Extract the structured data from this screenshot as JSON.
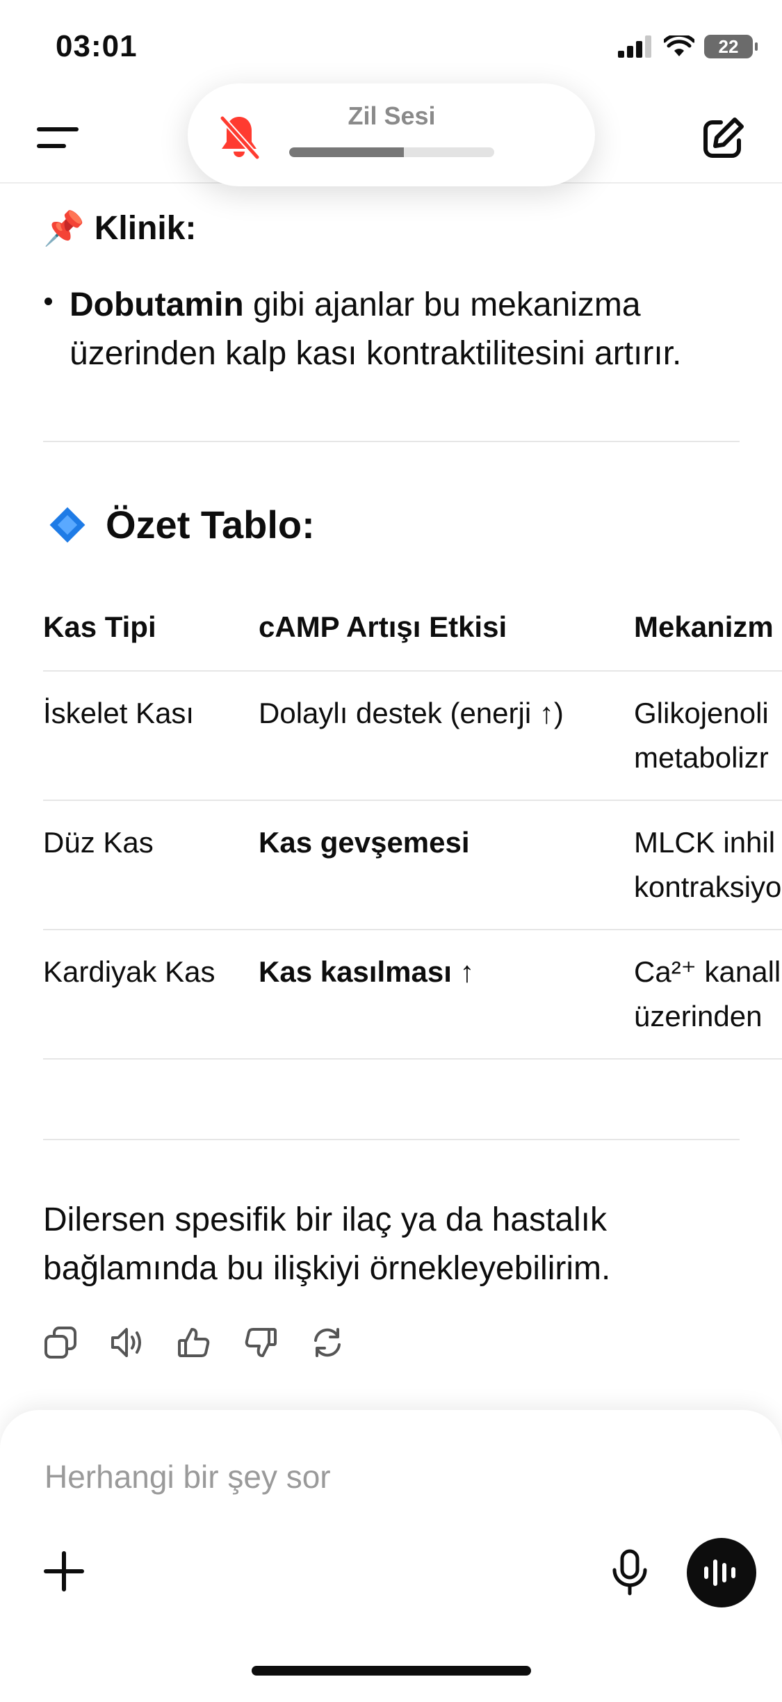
{
  "status_bar": {
    "time": "03:01",
    "battery": "22",
    "icons": [
      "signal-icon",
      "wifi-icon",
      "battery-icon"
    ]
  },
  "ringer": {
    "label": "Zil Sesi",
    "level_percent": 56,
    "icon": "bell-muted-icon",
    "accent": "#ff3b30"
  },
  "header": {
    "menu_icon": "menu-icon",
    "new_chat_icon": "edit-icon"
  },
  "message": {
    "klinik_emoji": "📌",
    "klinik_title": "Klinik:",
    "bullet_bold": "Dobutamin",
    "bullet_rest": " gibi ajanlar bu mekanizma üzerinden kalp kası kontraktilitesini artırır.",
    "ozet_emoji": "🔷",
    "ozet_title": "Özet Tablo:",
    "table": {
      "headers": [
        "Kas Tipi",
        "cAMP Artışı Etkisi",
        "Mekanizm"
      ],
      "rows": [
        {
          "c1": "İskelet Kası",
          "c2": "Dolaylı destek (enerji ↑)",
          "c3_line1": "Glikojenoli",
          "c3_line2": "metabolizr"
        },
        {
          "c1": "Düz Kas",
          "c2": "Kas gevşemesi",
          "c3_line1": "MLCK inhil",
          "c3_line2": "kontraksiyo"
        },
        {
          "c1": "Kardiyak Kas",
          "c2": "Kas kasılması ↑",
          "c3_line1": "Ca²⁺ kanall",
          "c3_line2": "üzerinden"
        }
      ]
    },
    "closing": "Dilersen spesifik bir ilaç ya da hastalık bağlamında bu ilişkiyi örnekleyebilirim."
  },
  "actions": [
    "copy-icon",
    "speaker-icon",
    "thumbs-up-icon",
    "thumbs-down-icon",
    "regenerate-icon"
  ],
  "composer": {
    "placeholder": "Herhangi bir şey sor",
    "value": ""
  }
}
